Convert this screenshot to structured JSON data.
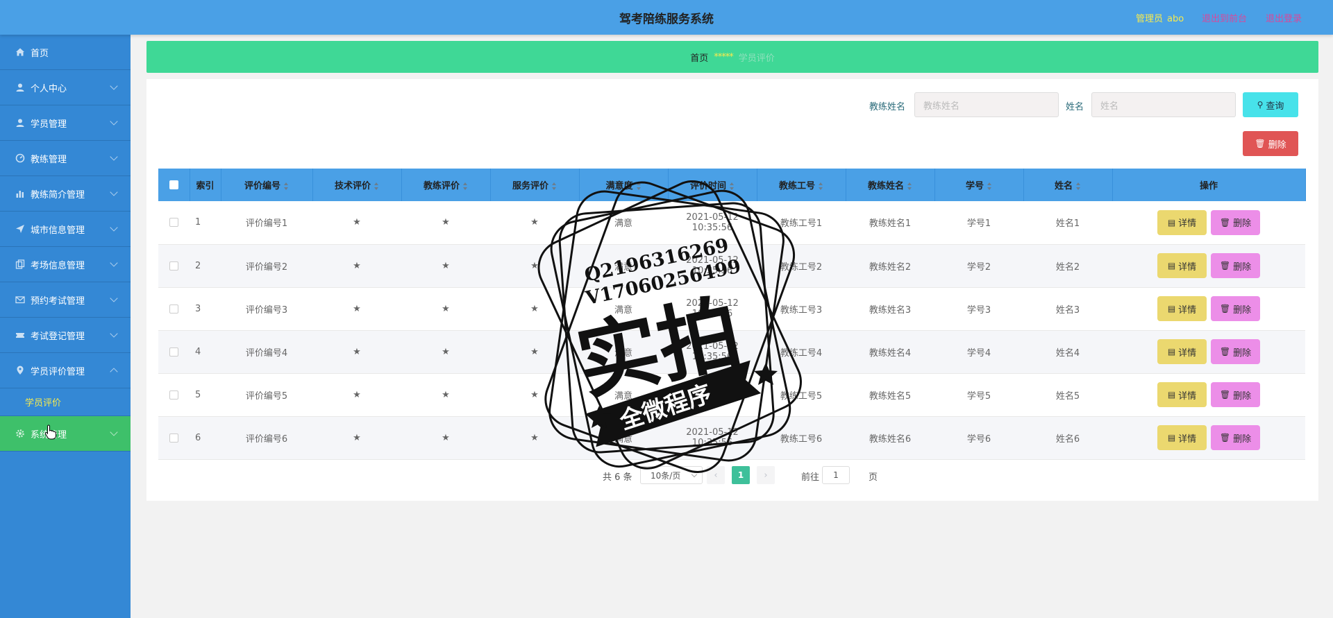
{
  "header": {
    "title": "驾考陪练服务系统",
    "admin_label": "管理员",
    "admin_name": "abo",
    "back_link": "退出到前台",
    "logout_link": "退出登录"
  },
  "sidebar": {
    "items": [
      {
        "label": "首页",
        "icon": "home-icon"
      },
      {
        "label": "个人中心",
        "icon": "user-icon"
      },
      {
        "label": "学员管理",
        "icon": "user-icon"
      },
      {
        "label": "教练管理",
        "icon": "dashboard-icon"
      },
      {
        "label": "教练简介管理",
        "icon": "bar-chart-icon"
      },
      {
        "label": "城市信息管理",
        "icon": "send-icon"
      },
      {
        "label": "考场信息管理",
        "icon": "copy-icon"
      },
      {
        "label": "预约考试管理",
        "icon": "mail-icon"
      },
      {
        "label": "考试登记管理",
        "icon": "ticket-icon"
      },
      {
        "label": "学员评价管理",
        "icon": "location-icon"
      },
      {
        "label": "系统管理",
        "icon": "gear-icon"
      }
    ],
    "submenu": {
      "label": "学员评价"
    }
  },
  "breadcrumb": {
    "home": "首页",
    "separator": "*****",
    "current": "学员评价"
  },
  "search": {
    "coach_label": "教练姓名",
    "coach_placeholder": "教练姓名",
    "name_label": "姓名",
    "name_placeholder": "姓名",
    "query_button": "查询",
    "delete_button": "删除"
  },
  "table": {
    "headers": [
      "索引",
      "评价编号",
      "技术评价",
      "教练评价",
      "服务评价",
      "满意度",
      "评价时间",
      "教练工号",
      "教练姓名",
      "学号",
      "姓名",
      "操作"
    ],
    "rows": [
      {
        "index": "1",
        "code": "评价编号1",
        "tech": "★",
        "coach": "★",
        "service": "★",
        "satisfaction": "满意",
        "time": "2021-05-12 10:35:56",
        "coach_no": "教练工号1",
        "coach_name": "教练姓名1",
        "student_no": "学号1",
        "name": "姓名1"
      },
      {
        "index": "2",
        "code": "评价编号2",
        "tech": "★",
        "coach": "★",
        "service": "★",
        "satisfaction": "满意",
        "time": "2021-05-12 10:35:56",
        "coach_no": "教练工号2",
        "coach_name": "教练姓名2",
        "student_no": "学号2",
        "name": "姓名2"
      },
      {
        "index": "3",
        "code": "评价编号3",
        "tech": "★",
        "coach": "★",
        "service": "★",
        "satisfaction": "满意",
        "time": "2021-05-12 10:35:56",
        "coach_no": "教练工号3",
        "coach_name": "教练姓名3",
        "student_no": "学号3",
        "name": "姓名3"
      },
      {
        "index": "4",
        "code": "评价编号4",
        "tech": "★",
        "coach": "★",
        "service": "★",
        "satisfaction": "满意",
        "time": "2021-05-12 10:35:56",
        "coach_no": "教练工号4",
        "coach_name": "教练姓名4",
        "student_no": "学号4",
        "name": "姓名4"
      },
      {
        "index": "5",
        "code": "评价编号5",
        "tech": "★",
        "coach": "★",
        "service": "★",
        "satisfaction": "满意",
        "time": "2021-05-12 10:35:56",
        "coach_no": "教练工号5",
        "coach_name": "教练姓名5",
        "student_no": "学号5",
        "name": "姓名5"
      },
      {
        "index": "6",
        "code": "评价编号6",
        "tech": "★",
        "coach": "★",
        "service": "★",
        "satisfaction": "满意",
        "time": "2021-05-12 10:35:56",
        "coach_no": "教练工号6",
        "coach_name": "教练姓名6",
        "student_no": "学号6",
        "name": "姓名6"
      }
    ],
    "detail_label": "详情",
    "delete_label": "删除"
  },
  "pagination": {
    "total": "共 6 条",
    "page_size": "10条/页",
    "current_page": "1",
    "goto_label": "前往",
    "goto_value": "1",
    "page_suffix": "页"
  },
  "watermark": {
    "line1": "Q2196316269",
    "line2": "V17060256499",
    "big": "实拍",
    "banner": "全微程序"
  },
  "colors": {
    "header_bg": "#4aa0e6",
    "sidebar_bg": "#3488d5",
    "active_menu": "#3ec06a",
    "breadcrumb_bg": "#3fd896",
    "query_button": "#47e2ea",
    "delete_button": "#e05555",
    "detail_button": "#ebd86f",
    "row_delete_button": "#ec8ee8"
  }
}
